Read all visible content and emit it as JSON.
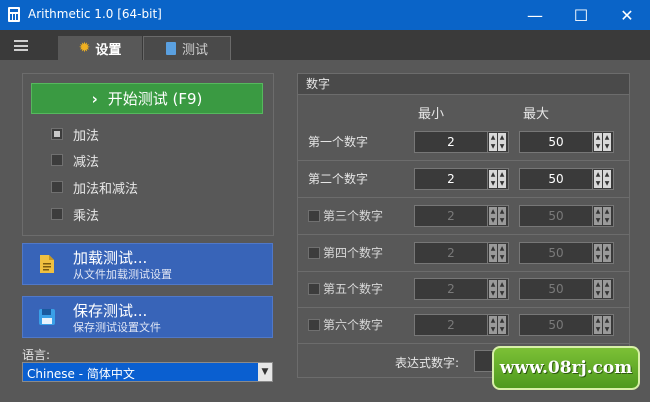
{
  "window": {
    "title": "Arithmetic 1.0  [64-bit]",
    "minimize": "—",
    "maximize": "☐",
    "close": "✕"
  },
  "tabs": [
    {
      "label": "设置",
      "icon": "gear-icon"
    },
    {
      "label": "测试",
      "icon": "calculator-icon"
    }
  ],
  "left": {
    "start_button": "开始测试 (F9)",
    "operations": [
      {
        "label": "加法",
        "checked": true
      },
      {
        "label": "减法",
        "checked": false
      },
      {
        "label": "加法和减法",
        "checked": false
      },
      {
        "label": "乘法",
        "checked": false
      }
    ],
    "load": {
      "title": "加载测试...",
      "subtitle": "从文件加载测试设置",
      "icon": "document-icon"
    },
    "save": {
      "title": "保存测试...",
      "subtitle": "保存测试设置文件",
      "icon": "floppy-disk-icon"
    },
    "language_label": "语言:",
    "language_value": "Chinese  -  简体中文"
  },
  "numbers": {
    "header": "数字",
    "col_min": "最小",
    "col_max": "最大",
    "rows": [
      {
        "label": "第一个数字",
        "min": "2",
        "max": "50",
        "enabled": true
      },
      {
        "label": "第二个数字",
        "min": "2",
        "max": "50",
        "enabled": true
      },
      {
        "label": "第三个数字",
        "min": "2",
        "max": "50",
        "enabled": false
      },
      {
        "label": "第四个数字",
        "min": "2",
        "max": "50",
        "enabled": false
      },
      {
        "label": "第五个数字",
        "min": "2",
        "max": "50",
        "enabled": false
      },
      {
        "label": "第六个数字",
        "min": "2",
        "max": "50",
        "enabled": false
      }
    ],
    "expression_label": "表达式数字:"
  },
  "watermark": "www.08rj.com",
  "colors": {
    "titlebar": "#0a64c8",
    "start": "#3a9a42",
    "action": "#3864b8",
    "background": "#585858"
  }
}
